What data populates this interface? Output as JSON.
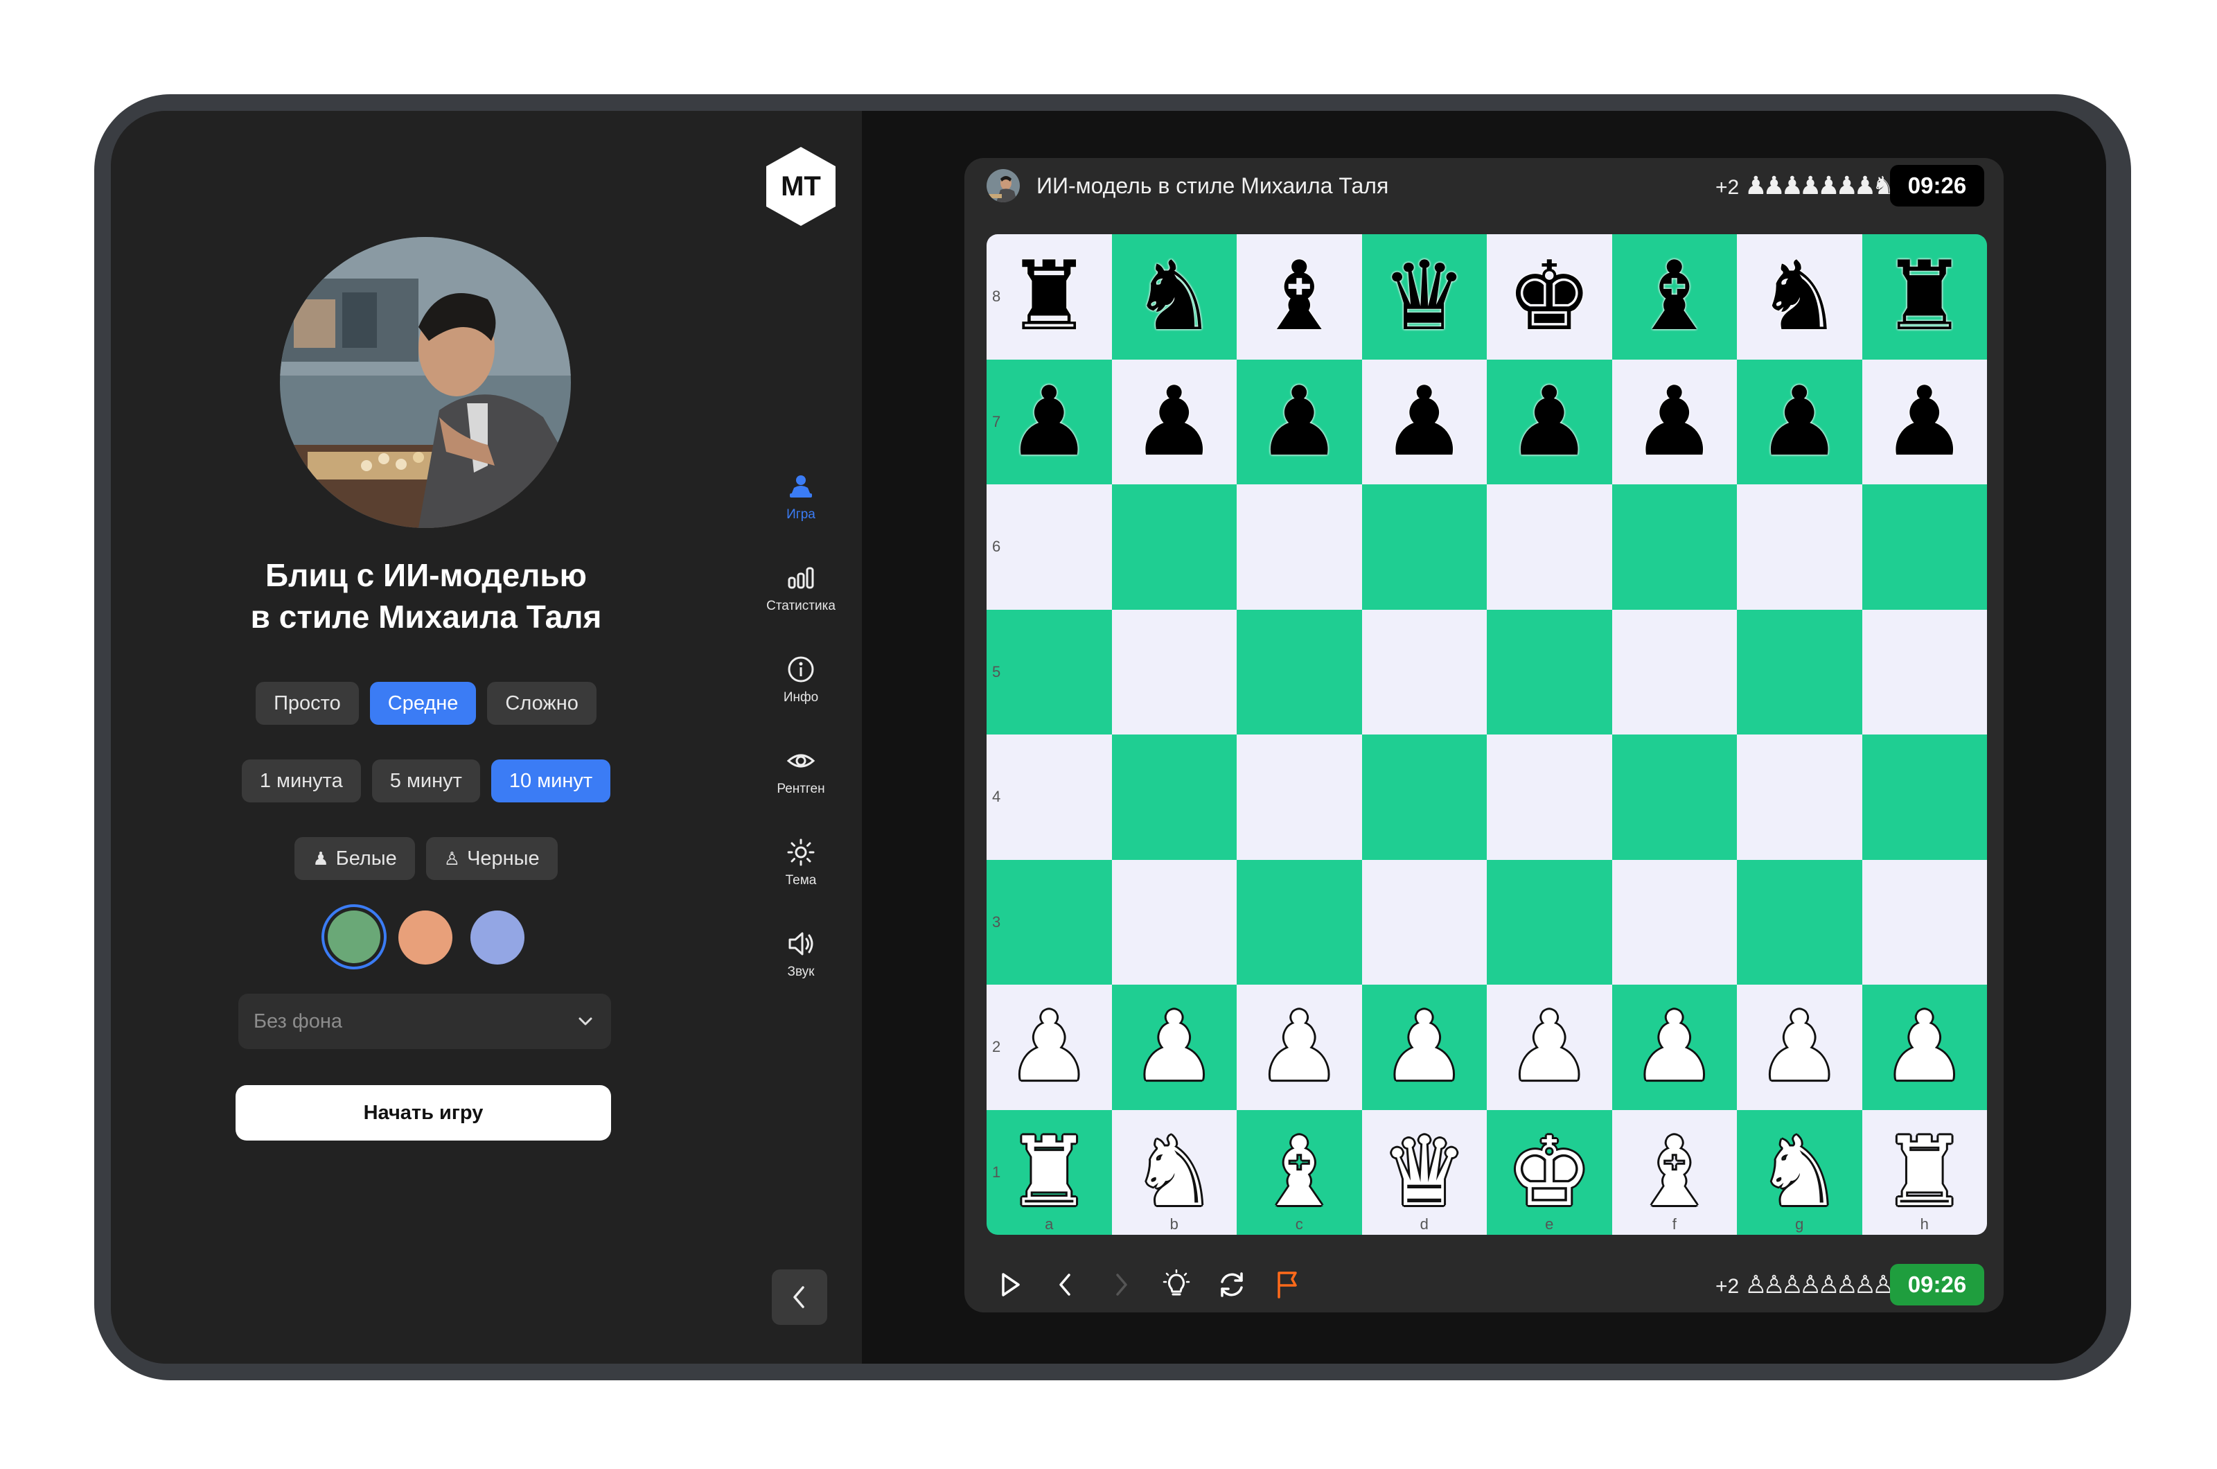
{
  "game": {
    "title_line1": "Блиц с ИИ-моделью",
    "title_line2": "в стиле Михаила Таля",
    "difficulty": [
      {
        "label": "Просто",
        "active": false
      },
      {
        "label": "Средне",
        "active": true
      },
      {
        "label": "Сложно",
        "active": false
      }
    ],
    "time": [
      {
        "label": "1 минута",
        "active": false
      },
      {
        "label": "5 минут",
        "active": false
      },
      {
        "label": "10 минут",
        "active": true
      }
    ],
    "side": [
      {
        "label": "Белые",
        "icon": "pawn-filled-icon"
      },
      {
        "label": "Черные",
        "icon": "pawn-outline-icon"
      }
    ],
    "colors": [
      "#6aa877",
      "#e8a07a",
      "#93a6e4"
    ],
    "selected_color": "#6aa877",
    "background_select": "Без фона",
    "start_label": "Начать игру"
  },
  "logo": "МТ",
  "nav": [
    {
      "label": "Игра",
      "icon": "game-icon",
      "active": true
    },
    {
      "label": "Статистика",
      "icon": "stats-icon",
      "active": false
    },
    {
      "label": "Инфо",
      "icon": "info-icon",
      "active": false
    },
    {
      "label": "Рентген",
      "icon": "eye-icon",
      "active": false
    },
    {
      "label": "Тема",
      "icon": "sun-icon",
      "active": false
    },
    {
      "label": "Звук",
      "icon": "sound-icon",
      "active": false
    }
  ],
  "board": {
    "opponent": "ИИ-модель в стиле Михаила Таля",
    "opponent_capture": "+2",
    "opponent_clock": "09:26",
    "player_capture": "+2",
    "player_clock": "09:26",
    "colors": {
      "light": "#f0f0fb",
      "dark": "#1fce92",
      "player_clock": "#1f9e3e",
      "opponent_clock": "#000000",
      "flag": "#ff6a1a"
    },
    "files": [
      "a",
      "b",
      "c",
      "d",
      "e",
      "f",
      "g",
      "h"
    ],
    "ranks": [
      "8",
      "7",
      "6",
      "5",
      "4",
      "3",
      "2",
      "1"
    ],
    "position": [
      [
        "r",
        "n",
        "b",
        "q",
        "k",
        "b",
        "n",
        "r"
      ],
      [
        "p",
        "p",
        "p",
        "p",
        "p",
        "p",
        "p",
        "p"
      ],
      [
        "",
        "",
        "",
        "",
        "",
        "",
        "",
        ""
      ],
      [
        "",
        "",
        "",
        "",
        "",
        "",
        "",
        ""
      ],
      [
        "",
        "",
        "",
        "",
        "",
        "",
        "",
        ""
      ],
      [
        "",
        "",
        "",
        "",
        "",
        "",
        "",
        ""
      ],
      [
        "P",
        "P",
        "P",
        "P",
        "P",
        "P",
        "P",
        "P"
      ],
      [
        "R",
        "N",
        "B",
        "Q",
        "K",
        "B",
        "N",
        "R"
      ]
    ],
    "controls": [
      "play-icon",
      "back-icon",
      "forward-icon",
      "hint-icon",
      "flip-icon",
      "resign-flag-icon"
    ]
  }
}
